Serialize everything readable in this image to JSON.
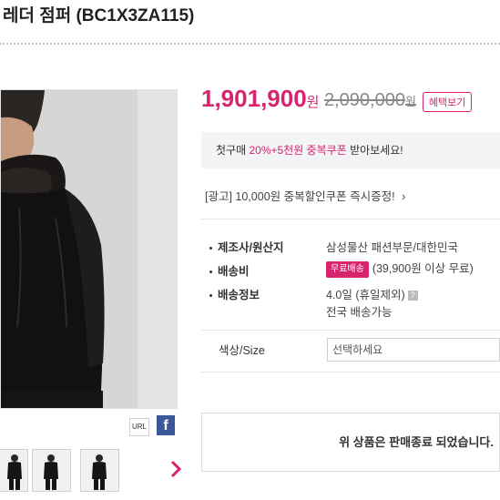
{
  "product": {
    "title": "레더 점퍼 (BC1X3ZA115)"
  },
  "gallery": {
    "url_label": "URL",
    "facebook_label": "f",
    "thumbnail_count": 3
  },
  "pricing": {
    "sale_price": "1,901,900",
    "sale_unit": "원",
    "original_price": "2,090,000",
    "original_unit": "원",
    "benefit_button": "혜택보기"
  },
  "coupon": {
    "prefix": "첫구매 ",
    "highlight": "20%+5천원 중복쿠폰",
    "suffix": " 받아보세요!"
  },
  "ad": {
    "text": "[광고] 10,000원 중복할인쿠폰 즉시증정!",
    "arrow": "›"
  },
  "info": {
    "maker_label": "제조사/원산지",
    "maker_value": "삼성물산 패션부문/대한민국",
    "shipping_fee_label": "배송비",
    "free_badge": "무료배송",
    "shipping_fee_value": "(39,900원 이상 무료)",
    "shipping_info_label": "배송정보",
    "shipping_days": "4.0일 (휴일제외)",
    "help_icon": "?",
    "shipping_area": "전국 배송가능"
  },
  "option": {
    "label": "색상/Size",
    "placeholder": "선택하세요"
  },
  "status": {
    "message": "위 상품은 판매종료 되었습니다."
  },
  "colors": {
    "accent": "#d6246e",
    "facebook": "#3b5998"
  }
}
